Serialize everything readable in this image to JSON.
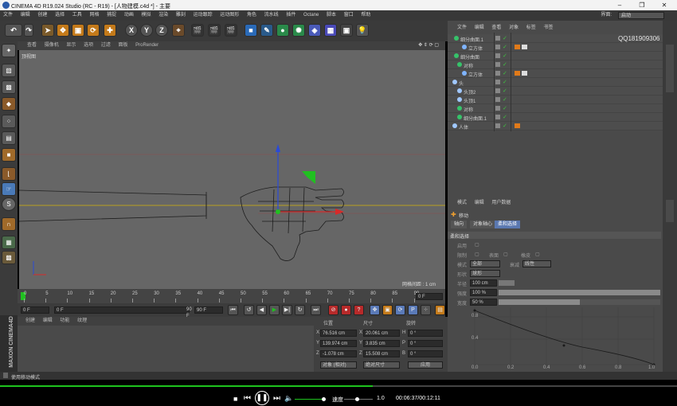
{
  "window": {
    "title": "CINEMA 4D R19.024 Studio (RC - R19) - [人物建模.c4d *] - 主要",
    "minimize": "–",
    "restore": "❐",
    "close": "✕"
  },
  "menubar": {
    "items": [
      "文件",
      "编辑",
      "创建",
      "选择",
      "工具",
      "网格",
      "捕捉",
      "动画",
      "模拟",
      "渲染",
      "雕刻",
      "运动跟踪",
      "运动图形",
      "角色",
      "流水线",
      "插件",
      "Octane",
      "脚本",
      "窗口",
      "帮助"
    ],
    "layout_label": "界面:",
    "layout_value": "启动"
  },
  "toolbar": {
    "axis_x": "X",
    "axis_y": "Y",
    "axis_z": "Z"
  },
  "viewport": {
    "menu": [
      "查看",
      "摄像机",
      "显示",
      "选项",
      "过滤",
      "面板",
      "ProRender"
    ],
    "label": "顶视图",
    "grid_spacing": "网格间距 : 1 cm"
  },
  "timeline": {
    "ticks": [
      "0",
      "5",
      "10",
      "15",
      "20",
      "25",
      "30",
      "35",
      "40",
      "45",
      "50",
      "55",
      "60",
      "65",
      "70",
      "75",
      "80",
      "85",
      "90"
    ],
    "end_field": "0 F",
    "start_frame": "0 F",
    "current_frame": "0 F",
    "range_end": "90 F",
    "max_frame": "90 F"
  },
  "material": {
    "menu": [
      "创建",
      "编辑",
      "功能",
      "纹理"
    ]
  },
  "coords": {
    "headers": {
      "position": "位置",
      "size": "尺寸",
      "rotation": "旋转"
    },
    "rows": [
      {
        "axis": "X",
        "pos": "76.516 cm",
        "saxis": "X",
        "size": "20.061 cm",
        "raxis": "H",
        "rot": "0 °"
      },
      {
        "axis": "Y",
        "pos": "139.974 cm",
        "saxis": "Y",
        "size": "3.835 cm",
        "raxis": "P",
        "rot": "0 °"
      },
      {
        "axis": "Z",
        "pos": "-1.078 cm",
        "saxis": "Z",
        "size": "15.508 cm",
        "raxis": "B",
        "rot": "0 °"
      }
    ],
    "mode_select": "对象 (相对)",
    "size_select": "绝对尺寸",
    "apply": "应用"
  },
  "objects": {
    "menu": [
      "文件",
      "编辑",
      "查看",
      "对象",
      "标签",
      "书签"
    ],
    "rows": [
      {
        "name": "细分曲面.1",
        "indent": 8,
        "color": "#36c36a",
        "tags": 0
      },
      {
        "name": "立方体",
        "indent": 18,
        "color": "#7fb4ff",
        "tags": 2
      },
      {
        "name": "细分曲面",
        "indent": 8,
        "color": "#36c36a",
        "tags": 0
      },
      {
        "name": "对称",
        "indent": 12,
        "color": "#36c36a",
        "tags": 0
      },
      {
        "name": "立方体",
        "indent": 18,
        "color": "#7fb4ff",
        "tags": 2
      },
      {
        "name": "头",
        "indent": 6,
        "color": "#a0c8ff",
        "tags": 0
      },
      {
        "name": "头顶2",
        "indent": 12,
        "color": "#a0c8ff",
        "tags": 0
      },
      {
        "name": "头顶1",
        "indent": 12,
        "color": "#a0c8ff",
        "tags": 0
      },
      {
        "name": "对称",
        "indent": 12,
        "color": "#36c36a",
        "tags": 0
      },
      {
        "name": "细分曲面.1",
        "indent": 12,
        "color": "#36c36a",
        "tags": 0
      },
      {
        "name": "人体",
        "indent": 6,
        "color": "#a0c8ff",
        "tags": 1
      }
    ]
  },
  "attributes": {
    "menu": [
      "模式",
      "编辑",
      "用户数据"
    ],
    "tool_name": "移动",
    "tabs": [
      "轴向",
      "对象轴心",
      "柔和选择"
    ],
    "section": "柔和选择",
    "rows": [
      {
        "label": "启用",
        "value": ""
      },
      {
        "label": "限制",
        "value": ""
      },
      {
        "label": "表面",
        "value": ""
      },
      {
        "label": "橡皮",
        "value": ""
      },
      {
        "label": "模式",
        "value": "全部"
      },
      {
        "label": "衰减",
        "value": "线性"
      },
      {
        "label": "形状",
        "value": "球形"
      },
      {
        "label": "半径",
        "value": "100 cm"
      },
      {
        "label": "强度",
        "value": "100 %"
      },
      {
        "label": "宽度",
        "value": "50 %"
      }
    ],
    "strength_fill": 1.0,
    "width_fill": 0.5,
    "graph_x_ticks": [
      "0.0",
      "0.2",
      "0.4",
      "0.6",
      "0.8",
      "1.0"
    ],
    "graph_y_ticks": [
      "0.8",
      "0.4"
    ]
  },
  "statusbar": {
    "text": "使用移动模式"
  },
  "player": {
    "speed_label": "速度",
    "speed_value": "1.0",
    "time": "00:06:37/00:12:11",
    "progress": 0.55
  },
  "watermark": "QQ181909306",
  "colors": {
    "ui_dark": "#3a3a3a",
    "viewport": "#666666",
    "accent_orange": "#f0a030",
    "accent_green": "#1ec31e"
  }
}
